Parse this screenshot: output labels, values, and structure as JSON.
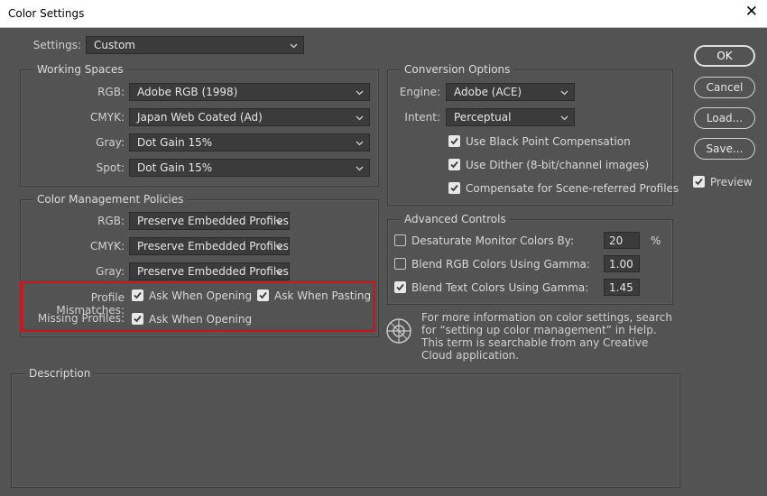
{
  "window": {
    "title": "Color Settings",
    "close_glyph": "✕"
  },
  "settings": {
    "label": "Settings:",
    "value": "Custom"
  },
  "working_spaces": {
    "title": "Working Spaces",
    "rgb": {
      "label": "RGB:",
      "value": "Adobe RGB (1998)"
    },
    "cmyk": {
      "label": "CMYK:",
      "value": "Japan Web Coated (Ad)"
    },
    "gray": {
      "label": "Gray:",
      "value": "Dot Gain 15%"
    },
    "spot": {
      "label": "Spot:",
      "value": "Dot Gain 15%"
    }
  },
  "policies": {
    "title": "Color Management Policies",
    "rgb": {
      "label": "RGB:",
      "value": "Preserve Embedded Profiles"
    },
    "cmyk": {
      "label": "CMYK:",
      "value": "Preserve Embedded Profiles"
    },
    "gray": {
      "label": "Gray:",
      "value": "Preserve Embedded Profiles"
    },
    "profile_mismatches": {
      "label": "Profile Mismatches:",
      "ask_opening": {
        "label": "Ask When Opening",
        "checked": true
      },
      "ask_pasting": {
        "label": "Ask When Pasting",
        "checked": true
      }
    },
    "missing_profiles": {
      "label": "Missing Profiles:",
      "ask_opening": {
        "label": "Ask When Opening",
        "checked": true
      }
    }
  },
  "conversion": {
    "title": "Conversion Options",
    "engine": {
      "label": "Engine:",
      "value": "Adobe (ACE)"
    },
    "intent": {
      "label": "Intent:",
      "value": "Perceptual"
    },
    "black_point": {
      "label": "Use Black Point Compensation",
      "checked": true
    },
    "dither": {
      "label": "Use Dither (8-bit/channel images)",
      "checked": true
    },
    "scene_referred": {
      "label": "Compensate for Scene-referred Profiles",
      "checked": true
    }
  },
  "advanced": {
    "title": "Advanced Controls",
    "desaturate": {
      "label": "Desaturate Monitor Colors By:",
      "value": "20",
      "unit": "%",
      "checked": false
    },
    "blend_rgb": {
      "label": "Blend RGB Colors Using Gamma:",
      "value": "1.00",
      "checked": false
    },
    "blend_text": {
      "label": "Blend Text Colors Using Gamma:",
      "value": "1.45",
      "checked": true
    }
  },
  "info_text": "For more information on color settings, search for “setting up color management” in Help. This term is searchable from any Creative Cloud application.",
  "description": {
    "title": "Description"
  },
  "buttons": {
    "ok": "OK",
    "cancel": "Cancel",
    "load": "Load...",
    "save": "Save..."
  },
  "preview": {
    "label": "Preview",
    "checked": true
  },
  "colors": {
    "background": "#535353",
    "field": "#3b3b3b",
    "highlight": "#d0141a"
  }
}
